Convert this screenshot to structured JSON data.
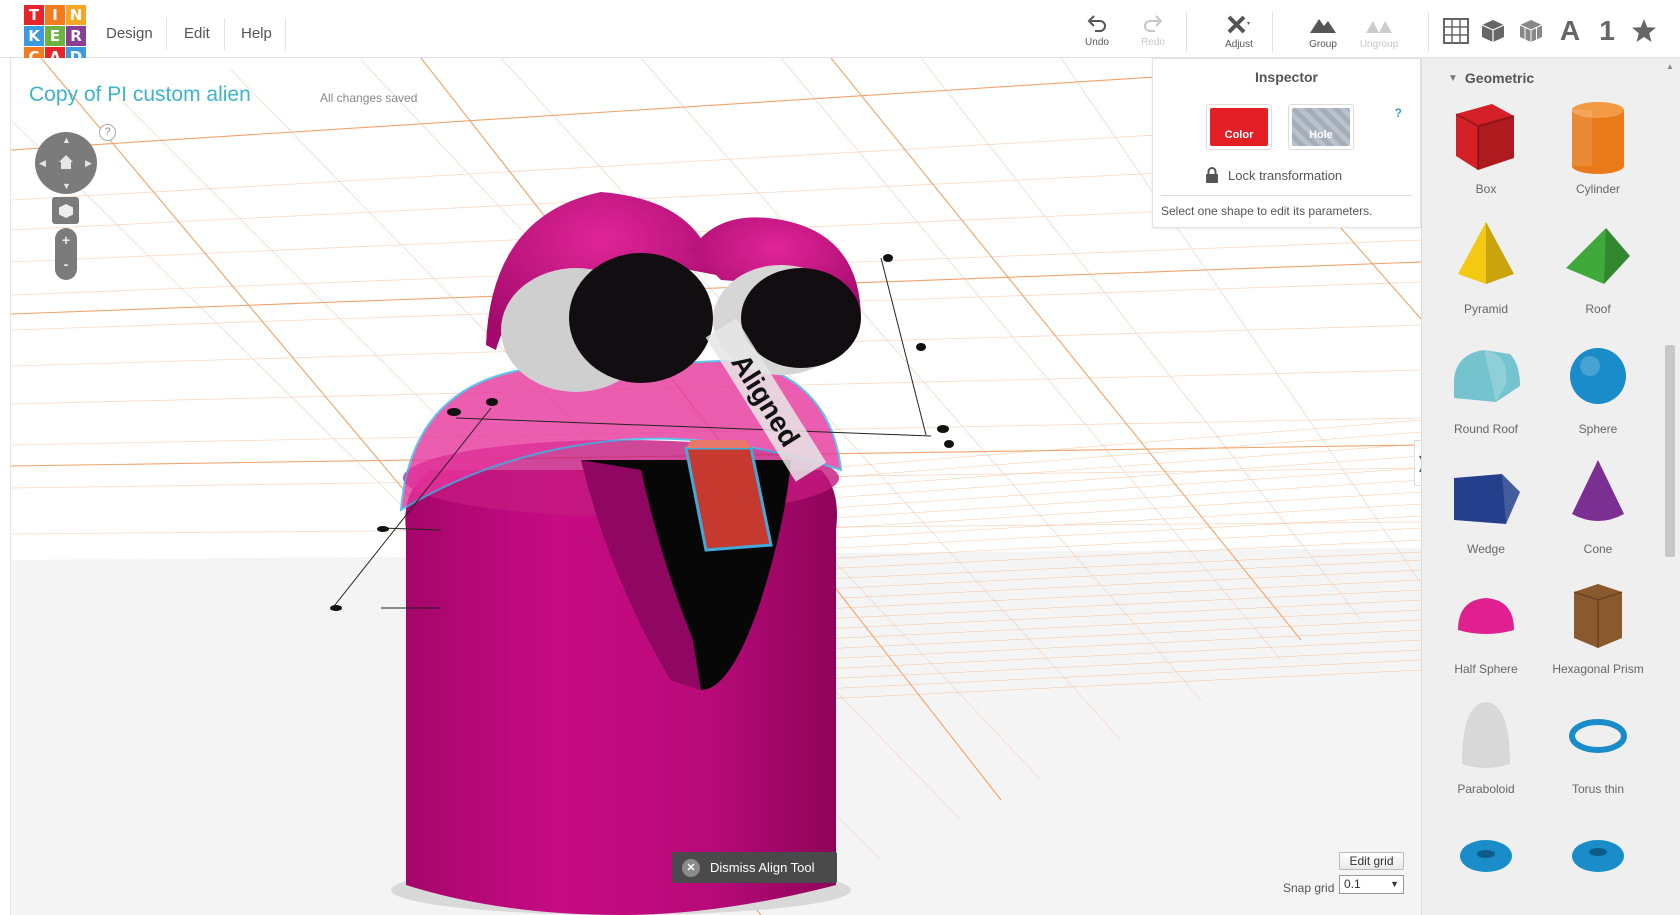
{
  "app": {
    "logo_letters": [
      "T",
      "I",
      "N",
      "K",
      "E",
      "R",
      "C",
      "A",
      "D"
    ],
    "logo_colors": [
      "#e8242a",
      "#f47a20",
      "#f6a623",
      "#3c9be0",
      "#6cb33f",
      "#8a3f96",
      "#f47a20",
      "#e8242a",
      "#3c9be0"
    ]
  },
  "menu": {
    "design": "Design",
    "edit": "Edit",
    "help": "Help"
  },
  "toolbar": {
    "undo": "Undo",
    "redo": "Redo",
    "adjust": "Adjust",
    "group": "Group",
    "ungroup": "Ungroup",
    "view_text_icon": "A",
    "view_number_icon": "1"
  },
  "project": {
    "title": "Copy of PI custom alien",
    "save_status": "All changes saved"
  },
  "nav": {
    "help": "?",
    "zoom_in": "+",
    "zoom_out": "-"
  },
  "inspector": {
    "title": "Inspector",
    "help": "?",
    "color_label": "Color",
    "hole_label": "Hole",
    "lock_label": "Lock transformation",
    "message": "Select one shape to edit its parameters.",
    "color_value": "#e31e24"
  },
  "scene": {
    "align_label": "Aligned"
  },
  "bottom": {
    "dismiss_label": "Dismiss Align Tool",
    "edit_grid_label": "Edit grid",
    "snap_grid_label": "Snap grid",
    "snap_grid_value": "0.1"
  },
  "panel": {
    "category": "Geometric",
    "shapes": [
      {
        "label": "Box",
        "icon": "box-icon",
        "color": "#d42127"
      },
      {
        "label": "Cylinder",
        "icon": "cylinder-icon",
        "color": "#e87a1a"
      },
      {
        "label": "Pyramid",
        "icon": "pyramid-icon",
        "color": "#f3c912"
      },
      {
        "label": "Roof",
        "icon": "roof-icon",
        "color": "#3fa93b"
      },
      {
        "label": "Round Roof",
        "icon": "round-roof-icon",
        "color": "#74c3cf"
      },
      {
        "label": "Sphere",
        "icon": "sphere-icon",
        "color": "#1a8cc9"
      },
      {
        "label": "Wedge",
        "icon": "wedge-icon",
        "color": "#243f8c"
      },
      {
        "label": "Cone",
        "icon": "cone-icon",
        "color": "#7b2f93"
      },
      {
        "label": "Half Sphere",
        "icon": "half-sphere-icon",
        "color": "#e0208f"
      },
      {
        "label": "Hexagonal Prism",
        "icon": "hexagonal-prism-icon",
        "color": "#8a5a2e"
      },
      {
        "label": "Paraboloid",
        "icon": "paraboloid-icon",
        "color": "#d8d8d8"
      },
      {
        "label": "Torus thin",
        "icon": "torus-thin-icon",
        "color": "#1a8cc9"
      }
    ]
  }
}
